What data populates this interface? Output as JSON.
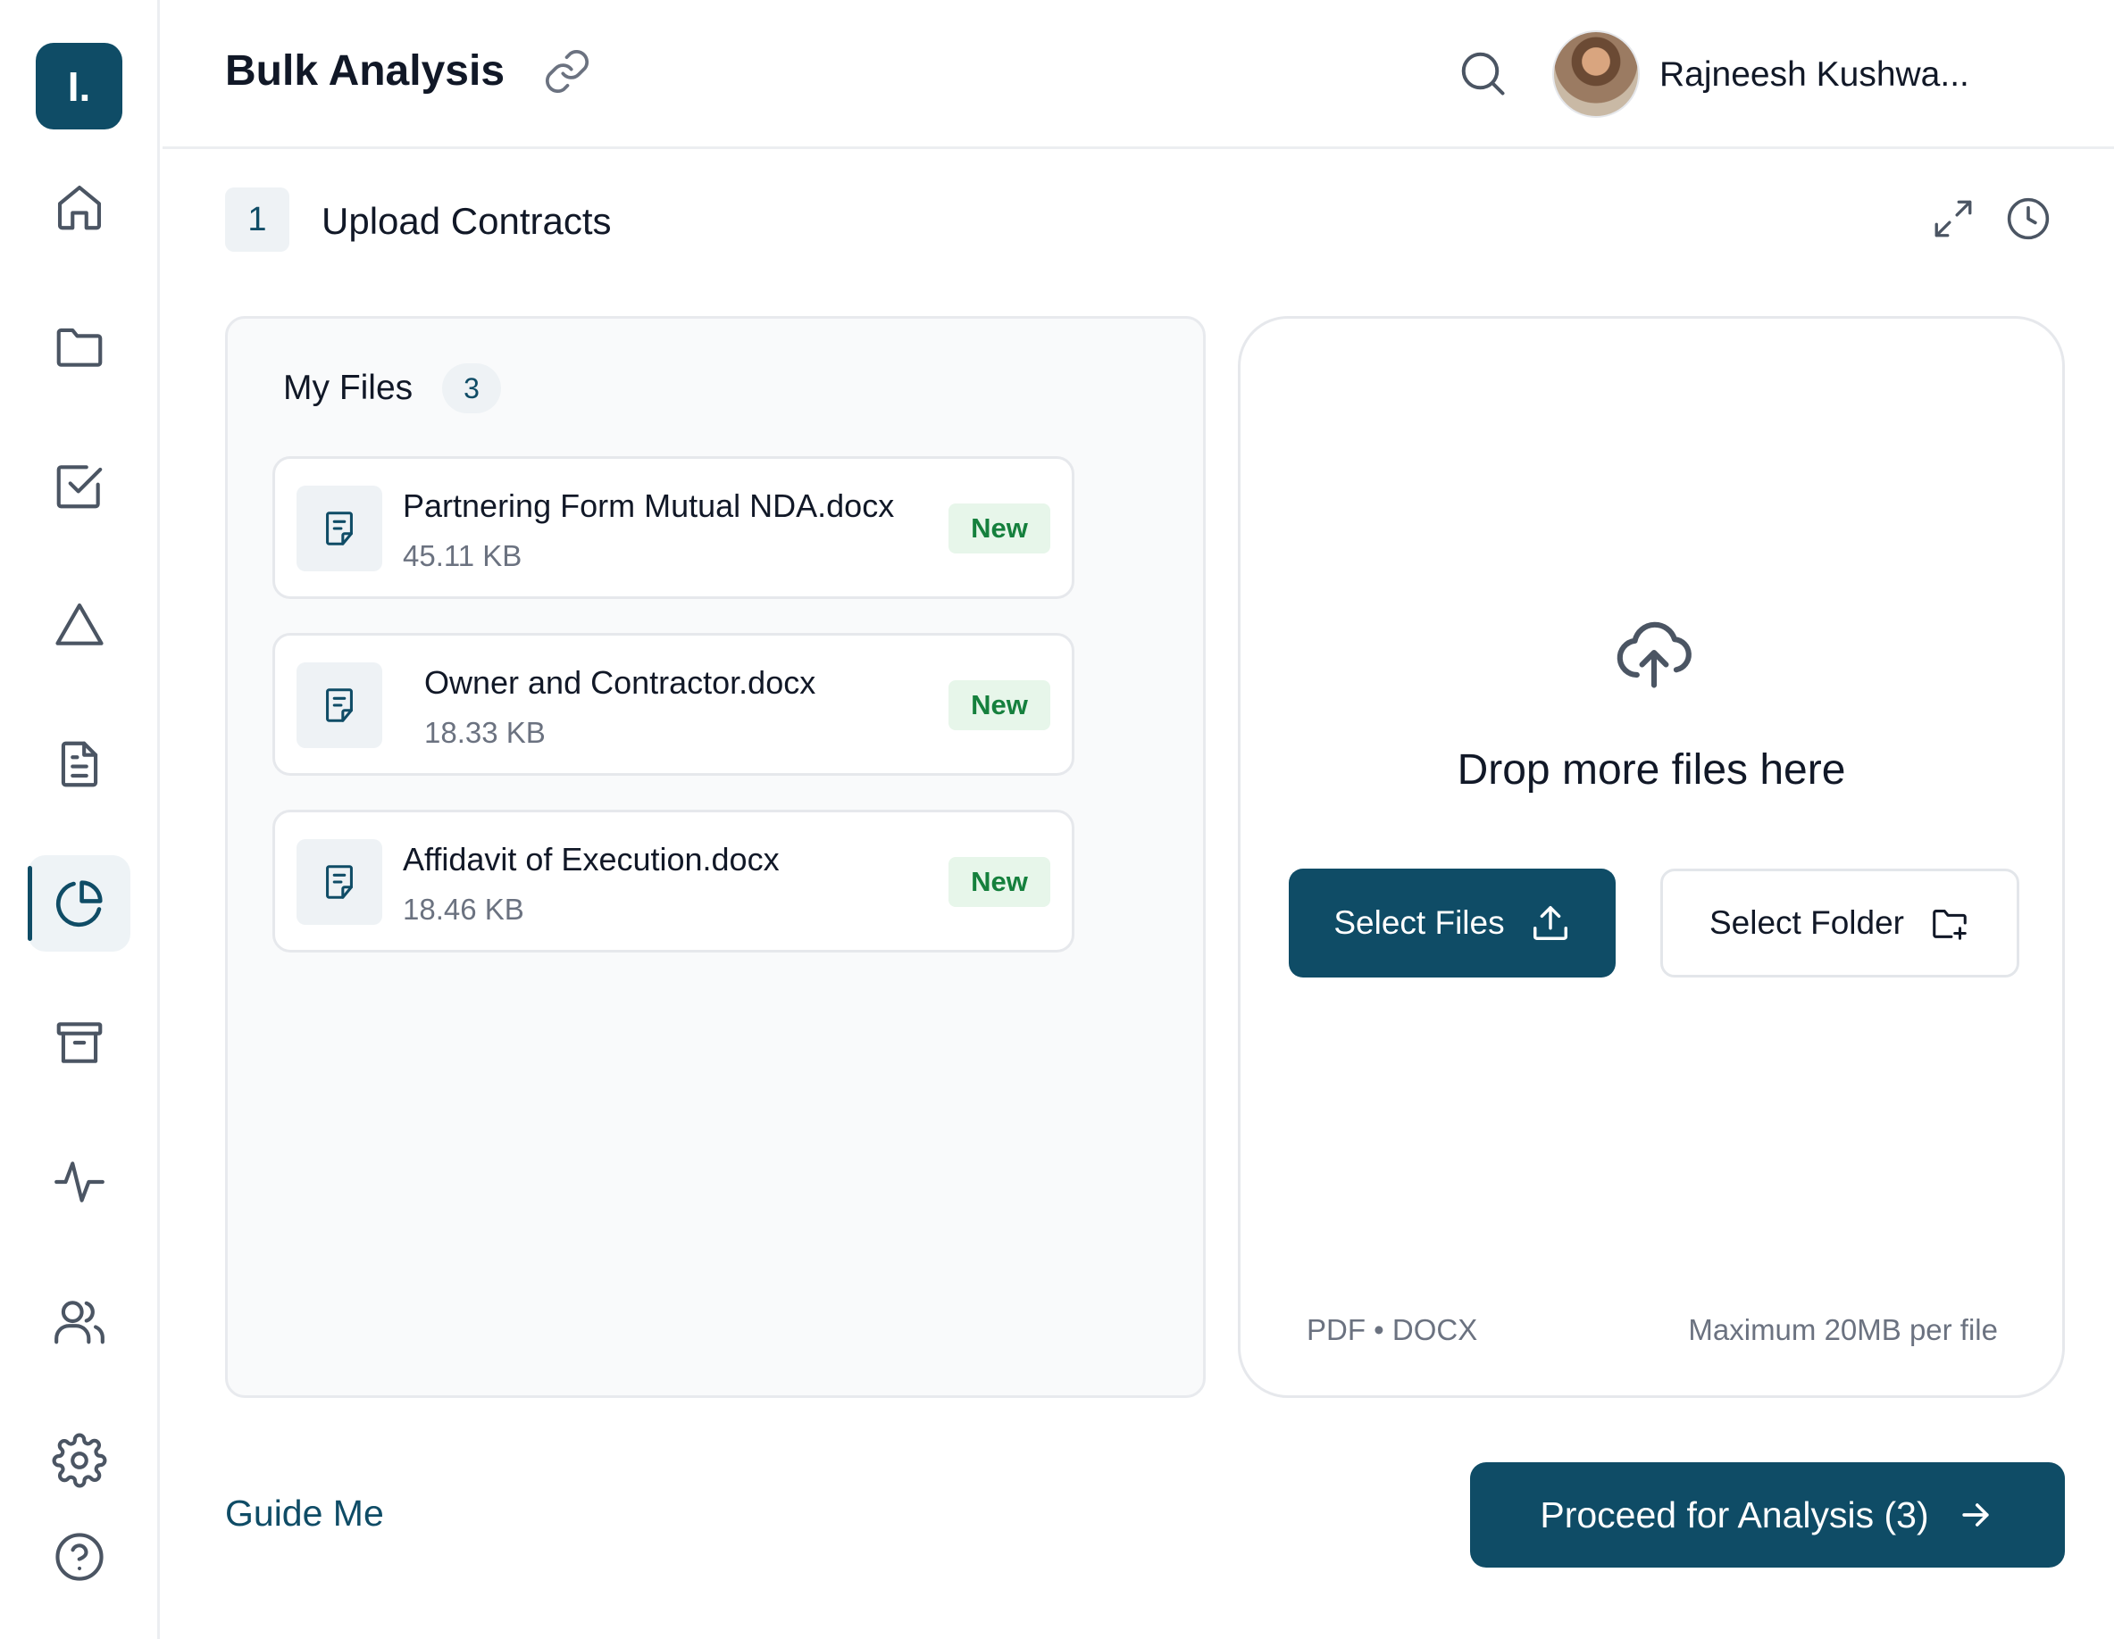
{
  "app": {
    "logo_text": "I."
  },
  "sidebar": {
    "items": [
      {
        "name": "home",
        "icon": "home-icon"
      },
      {
        "name": "folders",
        "icon": "folder-icon"
      },
      {
        "name": "tasks",
        "icon": "checkbox-icon"
      },
      {
        "name": "alerts",
        "icon": "triangle-icon"
      },
      {
        "name": "documents",
        "icon": "document-icon"
      },
      {
        "name": "bulk-analysis",
        "icon": "pie-chart-icon",
        "active": true
      },
      {
        "name": "archive",
        "icon": "archive-icon"
      },
      {
        "name": "activity",
        "icon": "activity-icon"
      },
      {
        "name": "users",
        "icon": "users-icon"
      },
      {
        "name": "settings",
        "icon": "gear-icon"
      },
      {
        "name": "help",
        "icon": "help-icon"
      }
    ]
  },
  "header": {
    "title": "Bulk Analysis",
    "user_name": "Rajneesh Kushwa..."
  },
  "step": {
    "number": "1",
    "title": "Upload Contracts"
  },
  "files_panel": {
    "heading": "My Files",
    "count": "3",
    "files": [
      {
        "name": "Partnering Form Mutual NDA.docx",
        "size": "45.11 KB",
        "badge": "New"
      },
      {
        "name": "Owner and Contractor.docx",
        "size": "18.33 KB",
        "badge": "New"
      },
      {
        "name": "Affidavit of Execution.docx",
        "size": "18.46 KB",
        "badge": "New"
      }
    ]
  },
  "drop_zone": {
    "text": "Drop more files here",
    "select_files_label": "Select Files",
    "select_folder_label": "Select Folder",
    "formats": "PDF • DOCX",
    "max_size": "Maximum 20MB per file"
  },
  "footer": {
    "guide_label": "Guide Me",
    "proceed_label": "Proceed for Analysis (3)"
  },
  "colors": {
    "primary": "#0f4c66",
    "badge_bg": "#e7f6ea",
    "badge_text": "#15803d",
    "muted": "#6b7280"
  }
}
